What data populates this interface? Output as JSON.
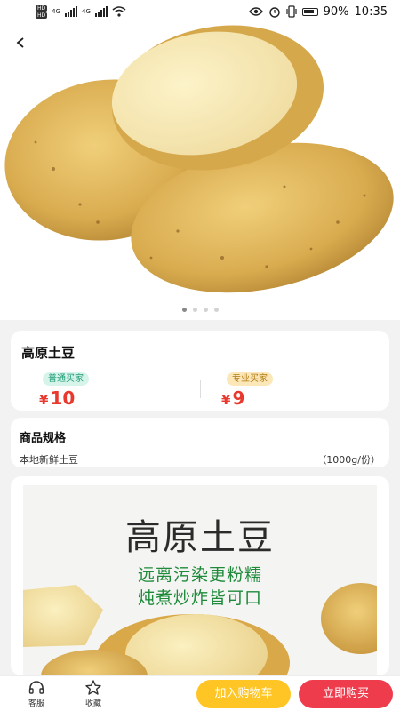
{
  "status_bar": {
    "hd1": "HD",
    "hd2": "HD",
    "net1": "4G",
    "net2": "4G",
    "battery": "90%",
    "time": "10:35"
  },
  "hero": {
    "image_desc": "potato-photo",
    "slide_count": 4,
    "active_slide": 1
  },
  "product": {
    "name": "高原土豆",
    "prices": [
      {
        "tag": "普通买家",
        "currency": "¥",
        "value": "10"
      },
      {
        "tag": "专业买家",
        "currency": "¥",
        "value": "9"
      }
    ]
  },
  "spec": {
    "title": "商品规格",
    "item_name": "本地新鲜土豆",
    "item_unit": "（1000g/份）"
  },
  "detail_banner": {
    "title": "高原土豆",
    "line1": "远离污染更粉糯",
    "line2": "炖煮炒炸皆可口"
  },
  "bottom_bar": {
    "service_label": "客服",
    "favorite_label": "收藏",
    "add_cart_label": "加入购物车",
    "buy_now_label": "立即购买"
  },
  "colors": {
    "price": "#e8392e",
    "cart_button": "#ffc524",
    "buy_button": "#ef3c4d",
    "banner_text_green": "#1e8a3a"
  }
}
